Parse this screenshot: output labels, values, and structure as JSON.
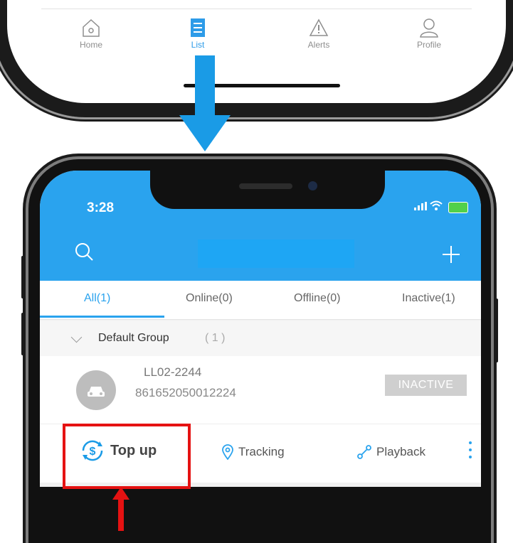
{
  "top_tabbar": {
    "tabs": [
      {
        "label": "Home",
        "icon": "home-icon",
        "active": false
      },
      {
        "label": "List",
        "icon": "list-icon",
        "active": true
      },
      {
        "label": "Alerts",
        "icon": "alert-icon",
        "active": false
      },
      {
        "label": "Profile",
        "icon": "profile-icon",
        "active": false
      }
    ]
  },
  "status_bar": {
    "time": "3:28"
  },
  "tabs": [
    {
      "label": "All(1)",
      "active": true
    },
    {
      "label": "Online(0)",
      "active": false
    },
    {
      "label": "Offline(0)",
      "active": false
    },
    {
      "label": "Inactive(1)",
      "active": false
    }
  ],
  "group": {
    "name": "Default Group",
    "count": "( 1 )"
  },
  "vehicle": {
    "plate": "LL02-2244",
    "imei": "861652050012224",
    "status": "INACTIVE"
  },
  "actions": {
    "top_up": "Top up",
    "tracking": "Tracking",
    "playback": "Playback"
  },
  "colors": {
    "primary": "#2aa3ee",
    "highlight": "#e51212",
    "arrow": "#1a9be6"
  }
}
